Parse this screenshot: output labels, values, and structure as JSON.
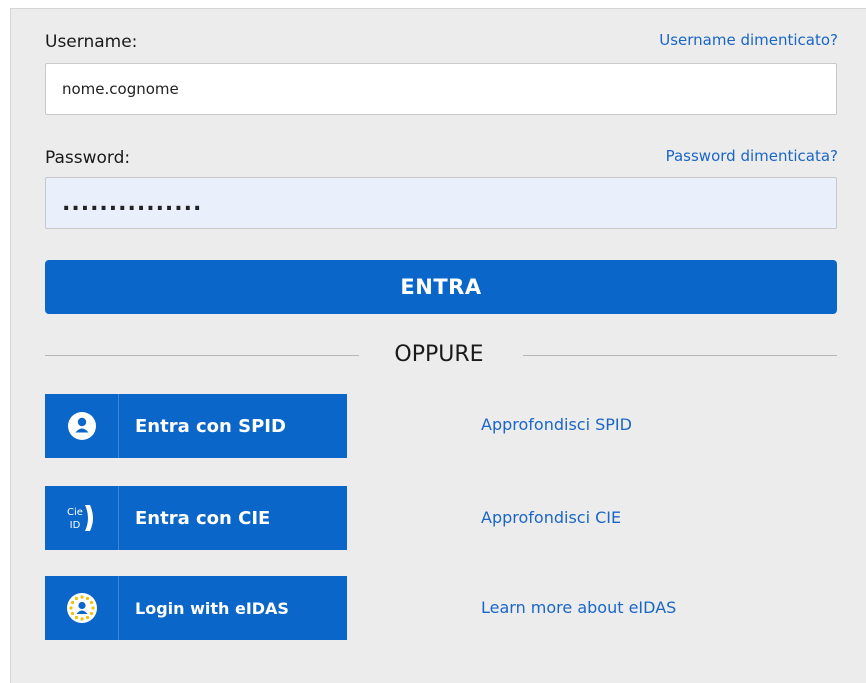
{
  "username": {
    "label": "Username:",
    "forgot_link": "Username dimenticato?",
    "value": "nome.cognome"
  },
  "password": {
    "label": "Password:",
    "forgot_link": "Password dimenticata?",
    "value": "..............."
  },
  "submit_label": "ENTRA",
  "separator_label": "OPPURE",
  "identity_options": [
    {
      "button_label": "Entra con SPID",
      "icon": "spid-user-icon",
      "info_link": "Approfondisci SPID"
    },
    {
      "button_label": "Entra con CIE",
      "icon": "cie-id-icon",
      "icon_text_top": "Cie",
      "icon_text_bottom": "ID",
      "info_link": "Approfondisci CIE"
    },
    {
      "button_label": "Login with eIDAS",
      "icon": "eidas-eu-icon",
      "info_link": "Learn more about eIDAS"
    }
  ],
  "colors": {
    "primary": "#0a66c8",
    "link": "#1a66c7",
    "panel_bg": "#ececec",
    "password_field_bg": "#e9f0fc"
  }
}
